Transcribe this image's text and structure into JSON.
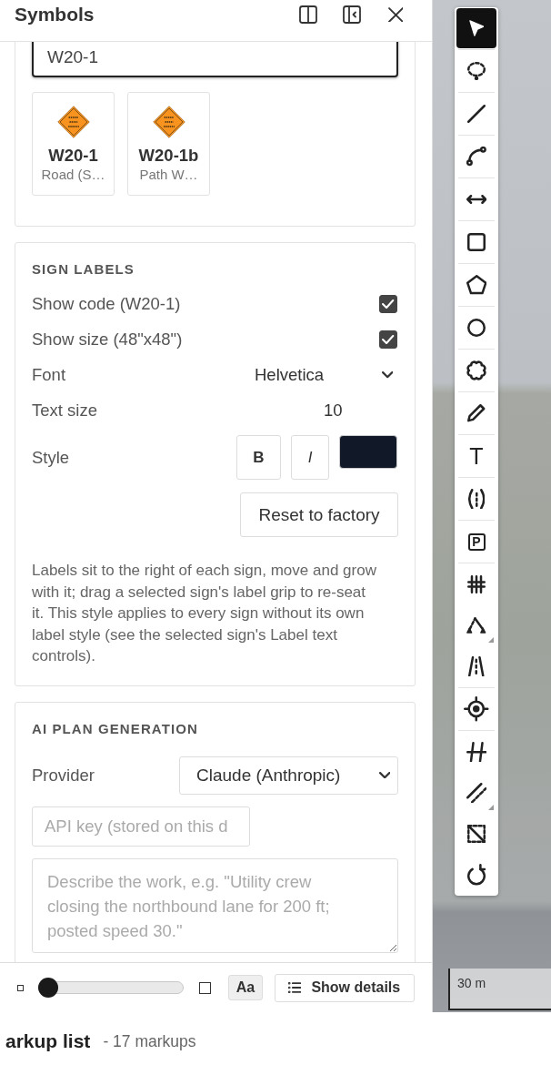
{
  "panel": {
    "title": "Symbols",
    "header_buttons": [
      {
        "kind": "split"
      },
      {
        "kind": "collapse"
      },
      {
        "kind": "close"
      }
    ]
  },
  "symbol_search": {
    "value": "W20-1",
    "focused": true,
    "results": [
      {
        "code": "W20-1",
        "name": "Road (S…"
      },
      {
        "code": "W20-1b",
        "name": "Path W…"
      }
    ]
  },
  "sign_labels": {
    "heading": "SIGN LABELS",
    "rows": [
      {
        "kind": "checkbox",
        "label": "Show code (W20-1)",
        "checked": true
      },
      {
        "kind": "checkbox",
        "label": "Show size (48\"x48\")",
        "checked": true
      },
      {
        "kind": "select",
        "label": "Font",
        "value": "Helvetica"
      },
      {
        "kind": "number",
        "label": "Text size",
        "value": "10"
      },
      {
        "kind": "style",
        "label": "Style",
        "bold": "B",
        "italic": "I",
        "color": "#111827"
      }
    ],
    "reset_button": "Reset to factory",
    "note": "Labels sit to the right of each sign, move and grow with it; drag a selected sign's label grip to re-seat it. This style applies to every sign without its own label style (see the selected sign's Label text controls)."
  },
  "ai_plan": {
    "heading": "AI PLAN GENERATION",
    "provider_label": "Provider",
    "provider": "Claude (Anthropic)",
    "api_key": {
      "placeholder": "API key (stored on this d"
    },
    "description": {
      "placeholder": "Describe the work, e.g. \"Utility crew closing the northbound lane for 200 ft; posted speed 30.\""
    }
  },
  "footer": {
    "zoom_slider": {
      "level": 0
    },
    "font_button": "Aa",
    "details_button": "Show details"
  },
  "map": {
    "tool_groups": [
      [
        {
          "kind": "select",
          "selected": true,
          "menu": false
        }
      ],
      [
        {
          "kind": "lasso",
          "selected": false,
          "menu": false
        }
      ],
      [
        {
          "kind": "line",
          "selected": false,
          "menu": false
        }
      ],
      [
        {
          "kind": "curve",
          "selected": false,
          "menu": false
        }
      ],
      [
        {
          "kind": "arrow",
          "selected": false,
          "menu": false
        }
      ],
      [
        {
          "kind": "rect",
          "selected": false,
          "menu": false
        }
      ],
      [
        {
          "kind": "polygon",
          "selected": false,
          "menu": false
        }
      ],
      [
        {
          "kind": "circle",
          "selected": false,
          "menu": false
        }
      ],
      [
        {
          "kind": "cloud",
          "selected": false,
          "menu": false
        }
      ],
      [
        {
          "kind": "pencil",
          "selected": false,
          "menu": false
        }
      ],
      [
        {
          "kind": "text",
          "glyph": "T",
          "selected": false,
          "menu": false
        }
      ],
      [
        {
          "kind": "lane",
          "selected": false,
          "menu": false
        }
      ],
      [
        {
          "kind": "parking",
          "glyph": "P",
          "selected": false,
          "menu": false
        }
      ],
      [
        {
          "kind": "grid",
          "selected": false,
          "menu": false
        },
        {
          "kind": "polyline",
          "selected": false,
          "menu": true
        },
        {
          "kind": "road",
          "selected": false,
          "menu": false
        }
      ],
      [
        {
          "kind": "target",
          "selected": false,
          "menu": false
        }
      ],
      [
        {
          "kind": "crossing",
          "selected": false,
          "menu": false
        },
        {
          "kind": "stripe",
          "selected": false,
          "menu": true
        },
        {
          "kind": "crop",
          "selected": false,
          "menu": false
        },
        {
          "kind": "rotate",
          "selected": false,
          "menu": false
        }
      ]
    ],
    "scale": "30 m"
  },
  "markup_list": {
    "title": "arkup list",
    "count": "- 17 markups"
  }
}
